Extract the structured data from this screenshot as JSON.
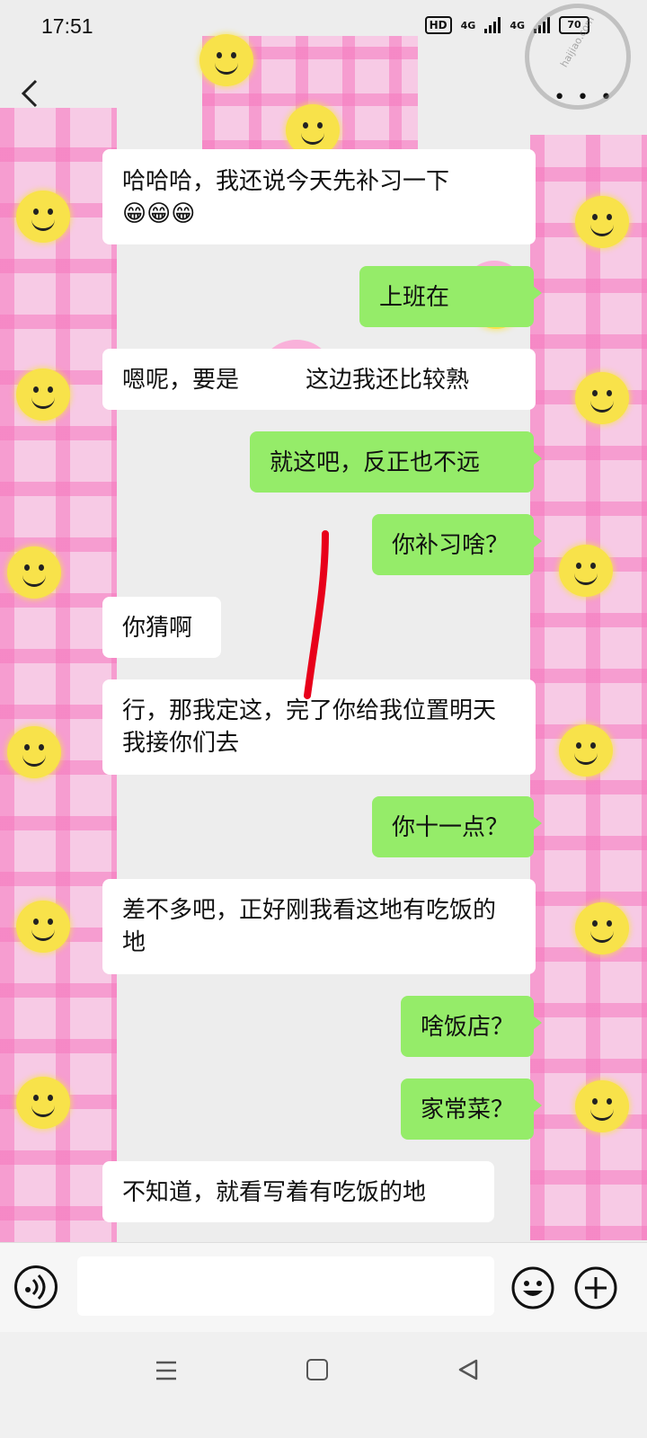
{
  "status_bar": {
    "time": "17:51",
    "hd_label": "HD",
    "network_1": "4G",
    "network_2": "4G",
    "battery": "70"
  },
  "header": {
    "back_icon": "chevron-left-icon",
    "more_label": "• • •"
  },
  "watermark": {
    "text": "haijiao.com"
  },
  "messages": [
    {
      "side": "in",
      "text": "哈哈哈，我还说今天先补习一下",
      "emoji": "😁😁😁"
    },
    {
      "side": "out",
      "text": "上班在"
    },
    {
      "side": "in",
      "text": "嗯呢，要是",
      "text_tail": "这边我还比较熟"
    },
    {
      "side": "out",
      "text": "就这吧，反正也不远"
    },
    {
      "side": "out",
      "text": "你补习啥？"
    },
    {
      "side": "in",
      "text": "你猜啊"
    },
    {
      "side": "in",
      "text": "行，那我定这，完了你给我位置明天我接你们去"
    },
    {
      "side": "out",
      "text": "你十一点？"
    },
    {
      "side": "in",
      "text": "差不多吧，正好刚我看这地有吃饭的地"
    },
    {
      "side": "out",
      "text": "啥饭店？"
    },
    {
      "side": "out",
      "text": "家常菜？"
    },
    {
      "side": "in",
      "text": "不知道，就看写着有吃饭的地"
    }
  ],
  "input_bar": {
    "voice_icon": "voice-icon",
    "emoji_icon": "emoji-icon",
    "plus_icon": "plus-icon",
    "text_value": ""
  },
  "nav_bar": {
    "menu_icon": "menu-icon",
    "home_icon": "home-icon",
    "back_icon": "back-triangle-icon"
  },
  "colors": {
    "background": "#ededed",
    "outgoing_bubble": "#95ec69",
    "incoming_bubble": "#ffffff",
    "decoration_pink": "#f578be",
    "decoration_yellow": "#f8e24a",
    "mark_red": "#e8001a"
  }
}
